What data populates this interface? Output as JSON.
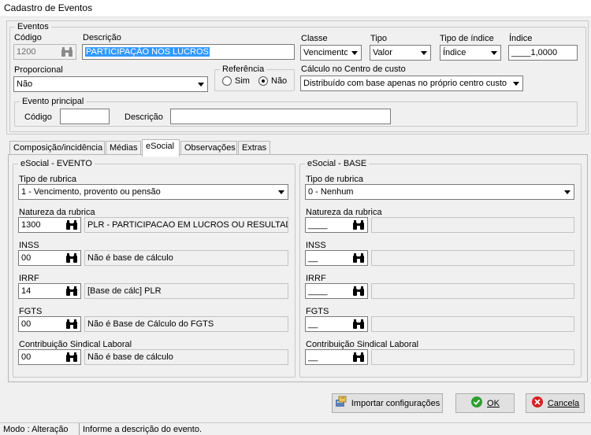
{
  "window": {
    "title": "Cadastro de Eventos"
  },
  "eventos": {
    "legend": "Eventos",
    "codigo_label": "Código",
    "codigo_value": "1200",
    "descricao_label": "Descrição",
    "descricao_value": "PARTICIPAÇÃO  NOS LUCROS",
    "classe_label": "Classe",
    "classe_value": "Vencimento",
    "tipo_label": "Tipo",
    "tipo_value": "Valor",
    "tipo_indice_label": "Tipo de índice",
    "tipo_indice_value": "Índice",
    "indice_label": "Índice",
    "indice_value": "____1,0000",
    "proporcional_label": "Proporcional",
    "proporcional_value": "Não",
    "referencia_legend": "Referência",
    "referencia_sim": "Sim",
    "referencia_nao": "Não",
    "referencia_selected": "Não",
    "calculo_label": "Cálculo no Centro de custo",
    "calculo_value": "Distribuído com base apenas no próprio centro custo"
  },
  "evento_principal": {
    "legend": "Evento principal",
    "codigo_label": "Código",
    "codigo_value": "",
    "descricao_label": "Descrição",
    "descricao_value": ""
  },
  "tabs": [
    {
      "label": "Composição/incidência"
    },
    {
      "label": "Médias"
    },
    {
      "label": "eSocial"
    },
    {
      "label": "Observações"
    },
    {
      "label": "Extras"
    }
  ],
  "active_tab": "eSocial",
  "esocial_evento": {
    "legend": "eSocial - EVENTO",
    "tipo_rubrica_label": "Tipo de rubrica",
    "tipo_rubrica_value": "1 - Vencimento, provento ou pensão",
    "natureza_label": "Natureza da rubrica",
    "natureza_code": "1300",
    "natureza_desc": "PLR - PARTICIPACAO EM LUCROS OU RESULTAD",
    "inss_label": "INSS",
    "inss_code": "00",
    "inss_desc": "Não é base de cálculo",
    "irrf_label": "IRRF",
    "irrf_code": "14",
    "irrf_desc": "[Base de cálc] PLR",
    "fgts_label": "FGTS",
    "fgts_code": "00",
    "fgts_desc": "Não é Base de Cálculo do FGTS",
    "sindical_label": "Contribuição Sindical Laboral",
    "sindical_code": "00",
    "sindical_desc": "Não é base de cálculo"
  },
  "esocial_base": {
    "legend": "eSocial - BASE",
    "tipo_rubrica_label": "Tipo de rubrica",
    "tipo_rubrica_value": "0 - Nenhum",
    "natureza_label": "Natureza da rubrica",
    "natureza_code": "____",
    "inss_label": "INSS",
    "inss_code": "__",
    "irrf_label": "IRRF",
    "irrf_code": "____",
    "fgts_label": "FGTS",
    "fgts_code": "__",
    "sindical_label": "Contribuição Sindical Laboral",
    "sindical_code": "__"
  },
  "buttons": {
    "importar": "Importar configurações",
    "ok": "OK",
    "cancelar": "Cancela"
  },
  "status": {
    "mode": "Modo : Alteração",
    "message": "Informe a descrição do evento."
  },
  "colors": {
    "selection": "#3399ff",
    "ok_green": "#2e9e2e",
    "cancel_red": "#d42020"
  }
}
